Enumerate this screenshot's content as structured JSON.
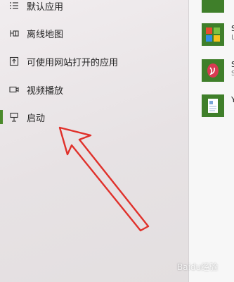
{
  "nav": {
    "items": [
      {
        "label": "默认应用",
        "icon": "default-apps-icon"
      },
      {
        "label": "离线地图",
        "icon": "offline-maps-icon"
      },
      {
        "label": "可使用网站打开的应用",
        "icon": "apps-for-websites-icon"
      },
      {
        "label": "视频播放",
        "icon": "video-playback-icon"
      },
      {
        "label": "启动",
        "icon": "startup-icon"
      }
    ],
    "active_index": 4
  },
  "apps": [
    {
      "letter": "",
      "sub": ""
    },
    {
      "letter": "S",
      "sub": "L"
    },
    {
      "letter": "S",
      "sub": "S"
    },
    {
      "letter": "Y",
      "sub": ""
    }
  ],
  "watermark": "Baidu经验",
  "colors": {
    "accent": "#4b8a2b",
    "tile": "#3f7f2a",
    "arrow": "#e0312b"
  }
}
